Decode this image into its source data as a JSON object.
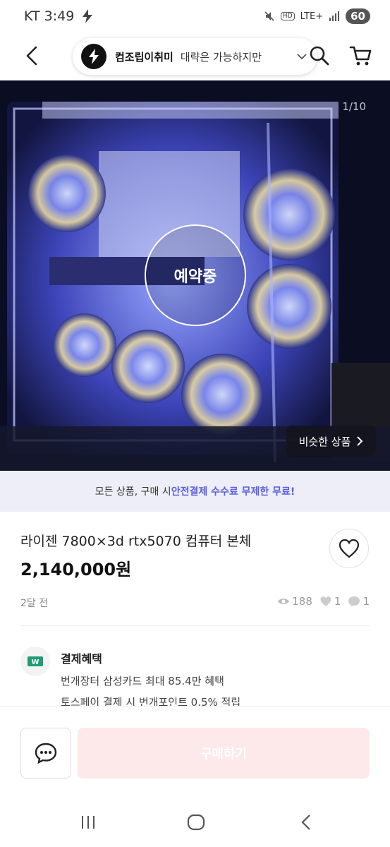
{
  "status_bar": {
    "carrier_time": "KT 3:49",
    "network": "LTE+",
    "hd": "HD",
    "battery": "60"
  },
  "header": {
    "store_name": "컴조립이취미",
    "store_tagline": "대략은 가능하지만"
  },
  "gallery": {
    "counter": "1/10",
    "status_overlay": "예약중",
    "similar_label": "비슷한 상품"
  },
  "promo": {
    "prefix": "모든 상품, 구매 시 ",
    "highlight": "안전결제 수수료 무제한 무료!"
  },
  "product": {
    "title": "라이젠 7800×3d rtx5070 컴퓨터 본체",
    "price": "2,140,000원",
    "posted": "2달 전",
    "views": "188",
    "likes": "1",
    "chats": "1"
  },
  "benefit": {
    "title": "결제혜택",
    "line1": "번개장터 삼성카드 최대 85.4만 혜택",
    "line2": "토스페이 결제 시 번개포인트 0.5% 적립"
  },
  "actions": {
    "buy_label": "구매하기"
  },
  "icons": {
    "back": "back-arrow-icon",
    "search": "search-icon",
    "cart": "cart-icon",
    "heart": "heart-icon",
    "chat": "chat-bubble-icon"
  },
  "colors": {
    "accent": "#5b5ee0",
    "buy_disabled": "#fde8ea",
    "promo_bg": "#eeeef8"
  }
}
